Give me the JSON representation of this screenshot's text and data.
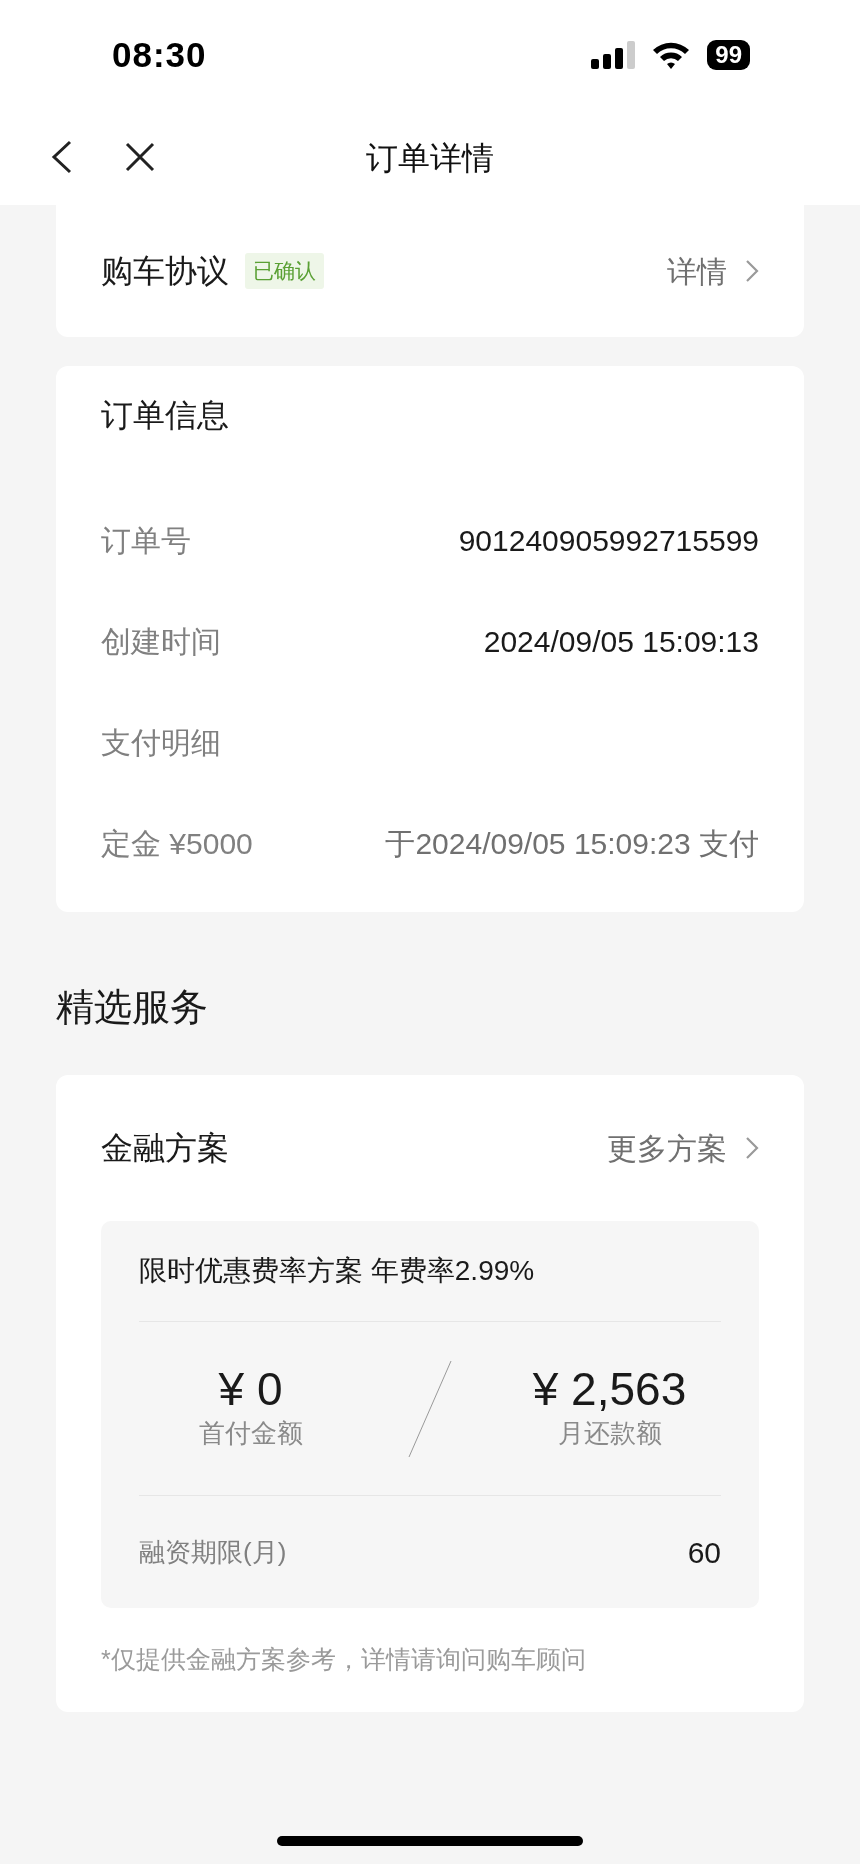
{
  "status_bar": {
    "time": "08:30",
    "battery": "99"
  },
  "nav": {
    "title": "订单详情"
  },
  "agreement": {
    "label": "购车协议",
    "tag": "已确认",
    "link": "详情"
  },
  "order_info": {
    "title": "订单信息",
    "rows": [
      {
        "label": "订单号",
        "value": "901240905992715599"
      },
      {
        "label": "创建时间",
        "value": "2024/09/05 15:09:13"
      },
      {
        "label": "支付明细"
      },
      {
        "label": "定金 ¥5000",
        "value": "于2024/09/05 15:09:23 支付"
      }
    ]
  },
  "section_title": "精选服务",
  "finance": {
    "title": "金融方案",
    "link": "更多方案",
    "plan": {
      "name": "限时优惠费率方案 年费率2.99%",
      "amounts": [
        {
          "value": "¥ 0",
          "label": "首付金额"
        },
        {
          "value": "¥ 2,563",
          "label": "月还款额"
        }
      ],
      "term_label": "融资期限(月)",
      "term_value": "60"
    },
    "note": "*仅提供金融方案参考，详情请询问购车顾问"
  }
}
